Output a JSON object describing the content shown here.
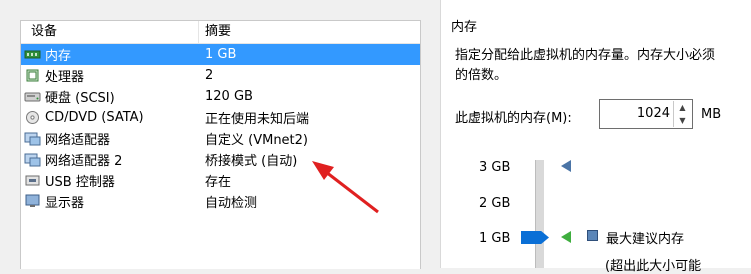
{
  "table": {
    "headers": [
      "设备",
      "摘要"
    ],
    "rows": [
      {
        "device": "内存",
        "summary": "1 GB",
        "icon": "memory-icon",
        "selected": true
      },
      {
        "device": "处理器",
        "summary": "2",
        "icon": "processor-icon"
      },
      {
        "device": "硬盘 (SCSI)",
        "summary": "120 GB",
        "icon": "hard-disk-icon"
      },
      {
        "device": "CD/DVD (SATA)",
        "summary": "正在使用未知后端",
        "icon": "cd-dvd-icon"
      },
      {
        "device": "网络适配器",
        "summary": "自定义 (VMnet2)",
        "icon": "network-adapter-icon"
      },
      {
        "device": "网络适配器 2",
        "summary": "桥接模式 (自动)",
        "icon": "network-adapter-icon"
      },
      {
        "device": "USB 控制器",
        "summary": "存在",
        "icon": "usb-icon"
      },
      {
        "device": "显示器",
        "summary": "自动检测",
        "icon": "monitor-icon"
      }
    ]
  },
  "memory_panel": {
    "title": "内存",
    "description_line1": "指定分配给此虚拟机的内存量。内存大小必须",
    "description_line2": "的倍数。",
    "memory_label": "此虚拟机的内存(M):",
    "memory_value": "1024",
    "unit": "MB",
    "ticks": [
      "3 GB",
      "2 GB",
      "1 GB"
    ],
    "legend_text": "最大建议内存",
    "legend_sub": "(超出此大小可能"
  },
  "colors": {
    "selection": "#3399ff",
    "slider_thumb": "#0a6fd6",
    "arrow": "#e02020"
  }
}
